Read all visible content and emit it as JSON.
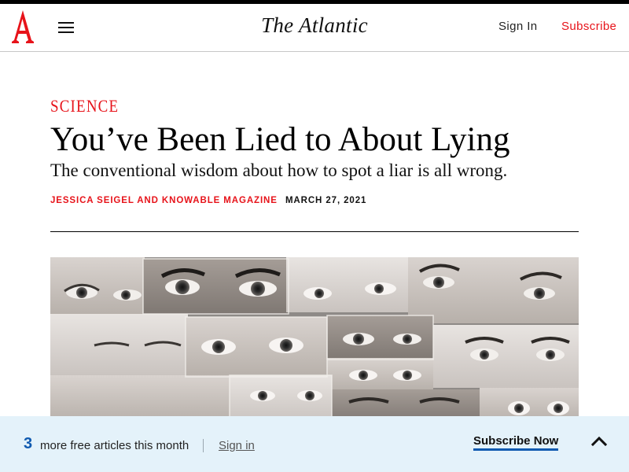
{
  "header": {
    "logo_letter": "A",
    "masthead": "The Atlantic",
    "sign_in": "Sign In",
    "subscribe": "Subscribe",
    "menu_icon": "hamburger-menu-icon"
  },
  "article": {
    "section": "SCIENCE",
    "headline": "You’ve Been Lied to About Lying",
    "dek": "The conventional wisdom about how to spot a liar is all wrong.",
    "authors": "JESSICA SEIGEL AND KNOWABLE MAGAZINE",
    "date": "MARCH 27, 2021"
  },
  "footer_bar": {
    "count": "3",
    "message": "more free articles this month",
    "sign_in": "Sign in",
    "subscribe_now": "Subscribe Now",
    "collapse_icon": "chevron-up-icon"
  },
  "colors": {
    "accent_red": "#e7131a",
    "footer_bg": "#e4f2fa",
    "link_blue": "#0f5ab0"
  }
}
